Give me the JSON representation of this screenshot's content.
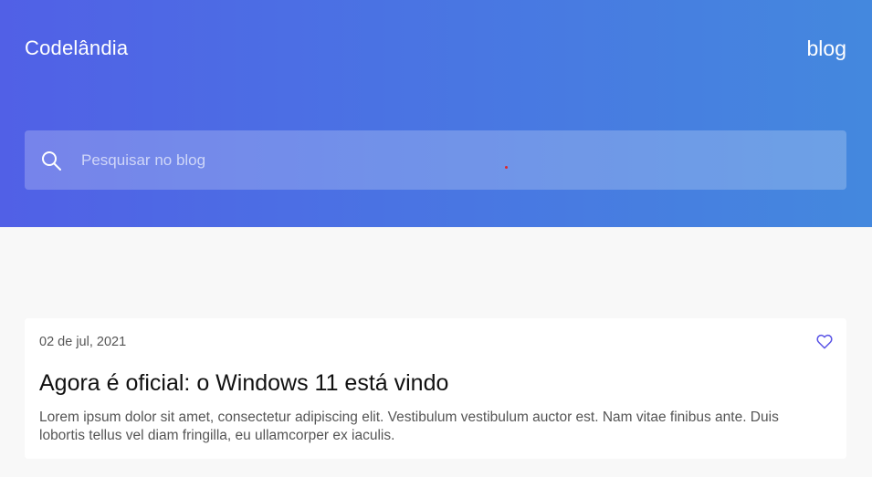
{
  "header": {
    "logo": "Codelândia",
    "nav_blog": "blog"
  },
  "search": {
    "placeholder": "Pesquisar no blog",
    "value": ""
  },
  "post": {
    "date": "02 de jul, 2021",
    "title": "Agora é oficial: o Windows 11 está vindo",
    "excerpt": "Lorem ipsum dolor sit amet, consectetur adipiscing elit. Vestibulum vestibulum auctor est. Nam vitae finibus ante. Duis lobortis tellus vel diam fringilla, eu ullamcorper ex iaculis.",
    "like_icon": "heart-outline-icon"
  },
  "colors": {
    "gradient_start": "#5160e6",
    "gradient_end": "#4488de",
    "accent": "#5a54e6",
    "background": "#f8f8f8"
  }
}
